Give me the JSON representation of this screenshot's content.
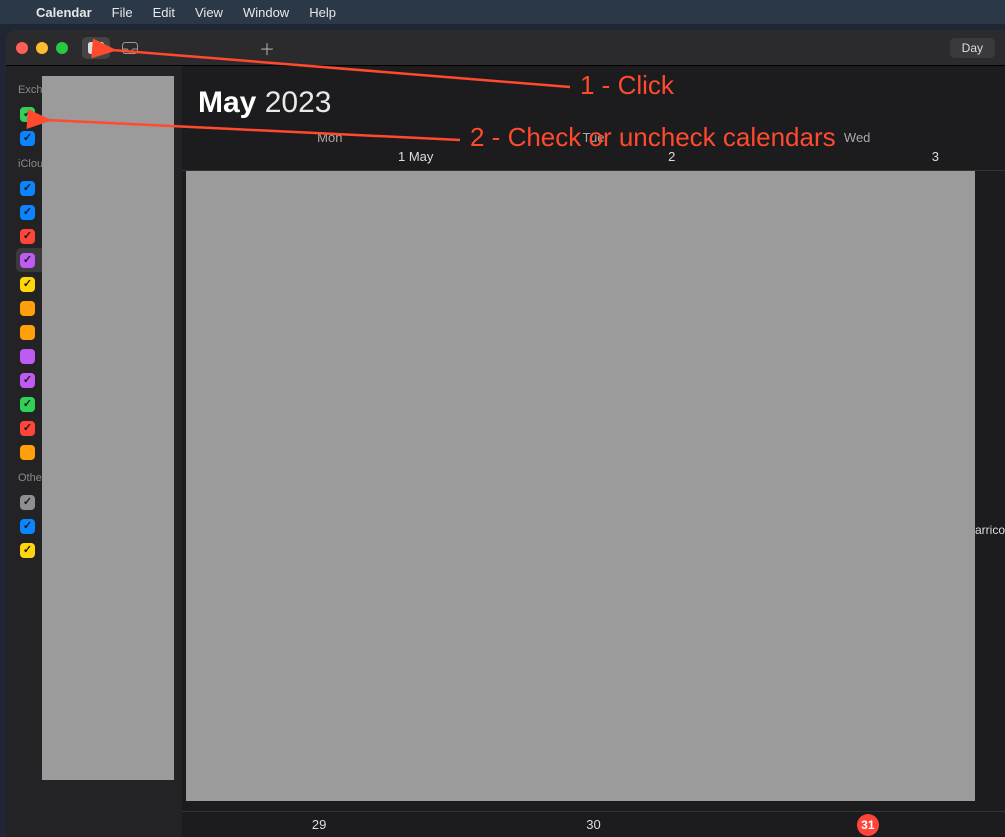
{
  "menubar": {
    "app": "Calendar",
    "items": [
      "File",
      "Edit",
      "View",
      "Window",
      "Help"
    ]
  },
  "toolbar": {
    "day_label": "Day"
  },
  "sidebar": {
    "sections": [
      {
        "label": "Exchange",
        "items": [
          {
            "checked": true,
            "color": "#30d158"
          },
          {
            "checked": true,
            "color": "#0a84ff"
          }
        ]
      },
      {
        "label": "iCloud",
        "items": [
          {
            "checked": true,
            "color": "#0a84ff"
          },
          {
            "checked": true,
            "color": "#0a84ff"
          },
          {
            "checked": true,
            "color": "#ff453a"
          },
          {
            "checked": true,
            "color": "#bf5af2",
            "selected": true
          },
          {
            "checked": true,
            "color": "#ffd60a"
          },
          {
            "checked": false,
            "color": "#ff9f0a"
          },
          {
            "checked": false,
            "color": "#ff9f0a"
          },
          {
            "checked": false,
            "color": "#bf5af2"
          },
          {
            "checked": true,
            "color": "#bf5af2"
          },
          {
            "checked": true,
            "color": "#30d158"
          },
          {
            "checked": true,
            "color": "#ff453a"
          },
          {
            "checked": false,
            "color": "#ff9f0a"
          }
        ]
      },
      {
        "label": "Other",
        "items": [
          {
            "checked": true,
            "color": "#8e8e93"
          },
          {
            "checked": true,
            "color": "#0a84ff"
          },
          {
            "checked": true,
            "color": "#ffd60a"
          }
        ]
      }
    ]
  },
  "calendar": {
    "month": "May",
    "year": "2023",
    "weekdays": [
      "Mon",
      "Tue",
      "Wed"
    ],
    "first_row_dates": [
      "1 May",
      "2",
      "3"
    ],
    "bottom_dates": [
      "29",
      "30",
      "31"
    ],
    "today": "31",
    "event_fragment": "arrico"
  },
  "annotations": {
    "a1": "1 - Click",
    "a2": "2 - Check or uncheck calendars"
  }
}
